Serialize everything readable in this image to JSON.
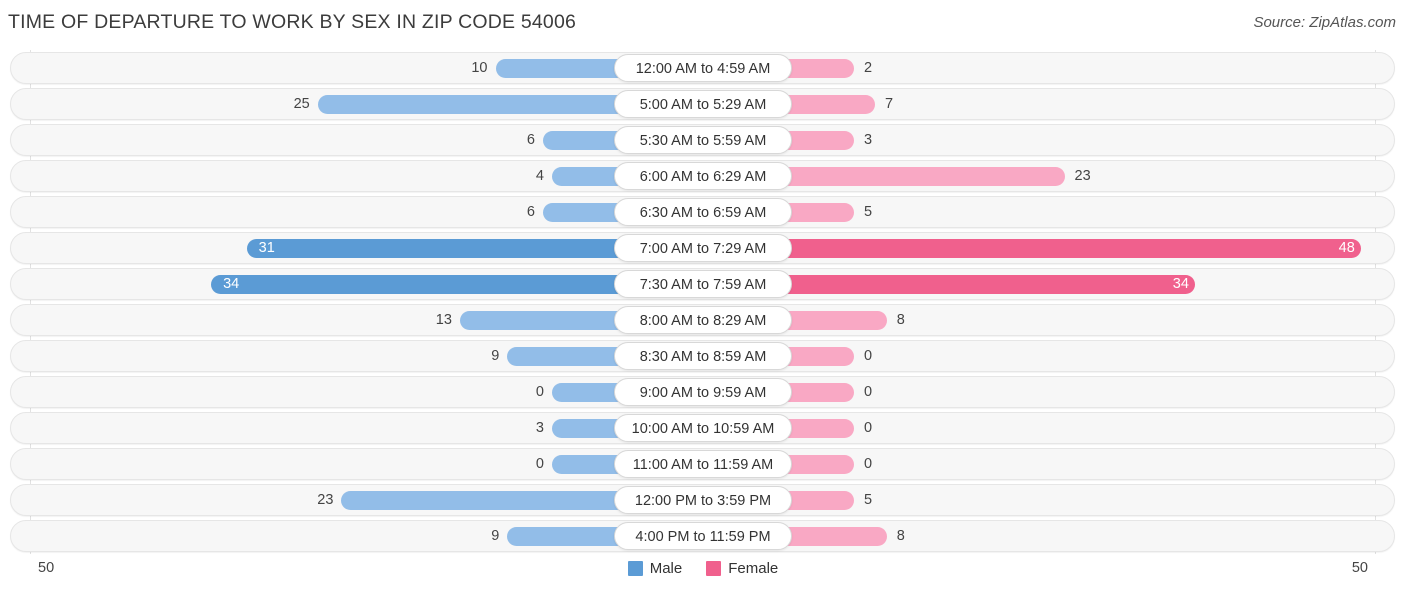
{
  "header": {
    "title": "TIME OF DEPARTURE TO WORK BY SEX IN ZIP CODE 54006",
    "source": "Source: ZipAtlas.com"
  },
  "axis": {
    "left_end": "50",
    "right_end": "50"
  },
  "legend": {
    "items": [
      {
        "label": "Male",
        "color": "#5b9bd5"
      },
      {
        "label": "Female",
        "color": "#f0608d"
      }
    ]
  },
  "chart_data": {
    "type": "bar",
    "subtype": "diverging-bidirectional",
    "title": "TIME OF DEPARTURE TO WORK BY SEX IN ZIP CODE 54006",
    "source": "Source: ZipAtlas.com",
    "xlabel": "",
    "ylabel": "",
    "xlim": [
      50,
      50
    ],
    "axis_left_max": 50,
    "axis_right_max": 50,
    "grid": true,
    "legend_position": "bottom-center",
    "categories": [
      "12:00 AM to 4:59 AM",
      "5:00 AM to 5:29 AM",
      "5:30 AM to 5:59 AM",
      "6:00 AM to 6:29 AM",
      "6:30 AM to 6:59 AM",
      "7:00 AM to 7:29 AM",
      "7:30 AM to 7:59 AM",
      "8:00 AM to 8:29 AM",
      "8:30 AM to 8:59 AM",
      "9:00 AM to 9:59 AM",
      "10:00 AM to 10:59 AM",
      "11:00 AM to 11:59 AM",
      "12:00 PM to 3:59 PM",
      "4:00 PM to 11:59 PM"
    ],
    "series": [
      {
        "name": "Male",
        "color": "#5b9bd5",
        "direction": "left",
        "values": [
          10,
          25,
          6,
          4,
          6,
          31,
          34,
          13,
          9,
          0,
          3,
          0,
          23,
          9
        ]
      },
      {
        "name": "Female",
        "color": "#f0608d",
        "direction": "right",
        "values": [
          2,
          7,
          3,
          23,
          5,
          48,
          34,
          8,
          0,
          0,
          0,
          0,
          5,
          8
        ]
      }
    ]
  }
}
